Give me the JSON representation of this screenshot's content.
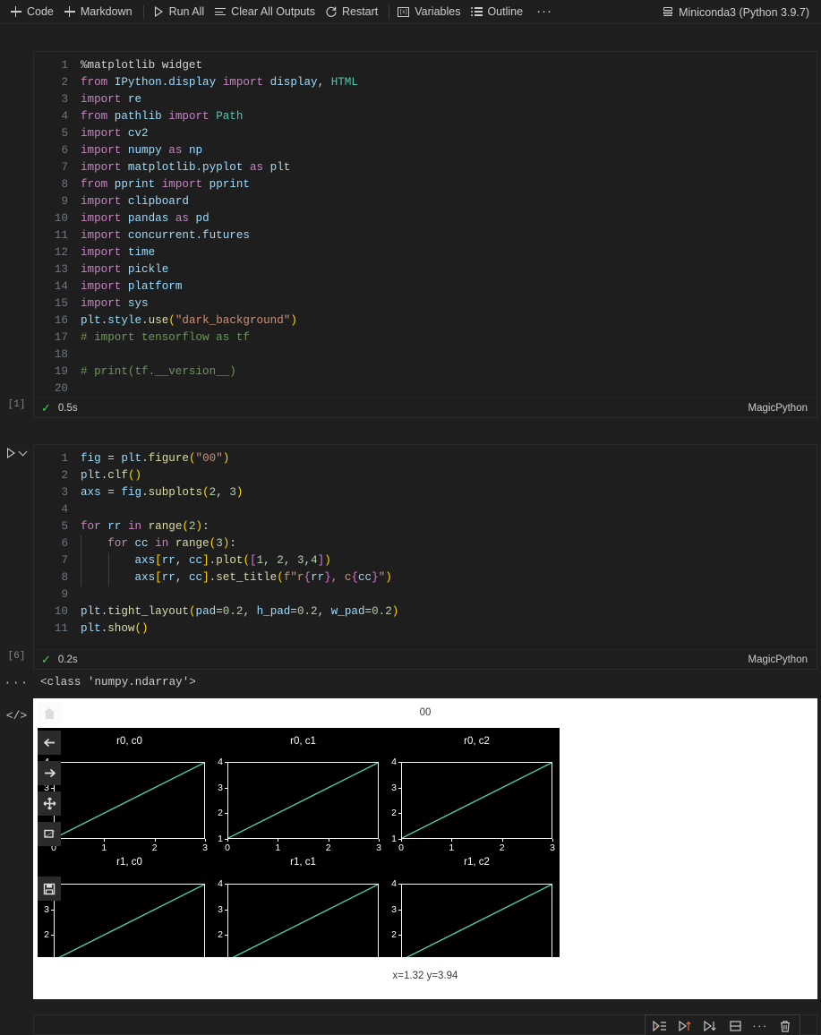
{
  "toolbar": {
    "items": [
      {
        "icon": "plus-icon",
        "label": "Code"
      },
      {
        "icon": "plus-icon",
        "label": "Markdown"
      },
      {
        "icon": "run-all-icon",
        "label": "Run All"
      },
      {
        "icon": "clear-outputs-icon",
        "label": "Clear All Outputs"
      },
      {
        "icon": "restart-icon",
        "label": "Restart"
      },
      {
        "icon": "variables-icon",
        "label": "Variables"
      },
      {
        "icon": "outline-icon",
        "label": "Outline"
      }
    ],
    "more_label": "···",
    "kernel": "Miniconda3 (Python 3.9.7)"
  },
  "cells": [
    {
      "execution_count": "[1]",
      "status_icon": "check-icon",
      "exec_time": "0.5s",
      "language_mode": "MagicPython",
      "lines": [
        {
          "n": "1",
          "tokens": [
            [
              "magic",
              "%matplotlib widget"
            ]
          ]
        },
        {
          "n": "2",
          "tokens": [
            [
              "key",
              "from"
            ],
            [
              "plain",
              " "
            ],
            [
              "mod",
              "IPython.display"
            ],
            [
              "plain",
              " "
            ],
            [
              "key",
              "import"
            ],
            [
              "plain",
              " "
            ],
            [
              "mod",
              "display"
            ],
            [
              "plain",
              ", "
            ],
            [
              "cls",
              "HTML"
            ]
          ]
        },
        {
          "n": "3",
          "tokens": [
            [
              "key",
              "import"
            ],
            [
              "plain",
              " "
            ],
            [
              "mod",
              "re"
            ]
          ]
        },
        {
          "n": "4",
          "tokens": [
            [
              "key",
              "from"
            ],
            [
              "plain",
              " "
            ],
            [
              "mod",
              "pathlib"
            ],
            [
              "plain",
              " "
            ],
            [
              "key",
              "import"
            ],
            [
              "plain",
              " "
            ],
            [
              "cls",
              "Path"
            ]
          ]
        },
        {
          "n": "5",
          "tokens": [
            [
              "key",
              "import"
            ],
            [
              "plain",
              " "
            ],
            [
              "mod",
              "cv2"
            ]
          ]
        },
        {
          "n": "6",
          "tokens": [
            [
              "key",
              "import"
            ],
            [
              "plain",
              " "
            ],
            [
              "mod",
              "numpy"
            ],
            [
              "plain",
              " "
            ],
            [
              "key",
              "as"
            ],
            [
              "plain",
              " "
            ],
            [
              "mod",
              "np"
            ]
          ]
        },
        {
          "n": "7",
          "tokens": [
            [
              "key",
              "import"
            ],
            [
              "plain",
              " "
            ],
            [
              "mod",
              "matplotlib.pyplot"
            ],
            [
              "plain",
              " "
            ],
            [
              "key",
              "as"
            ],
            [
              "plain",
              " "
            ],
            [
              "mod",
              "plt"
            ]
          ]
        },
        {
          "n": "8",
          "tokens": [
            [
              "key",
              "from"
            ],
            [
              "plain",
              " "
            ],
            [
              "mod",
              "pprint"
            ],
            [
              "plain",
              " "
            ],
            [
              "key",
              "import"
            ],
            [
              "plain",
              " "
            ],
            [
              "mod",
              "pprint"
            ]
          ]
        },
        {
          "n": "9",
          "tokens": [
            [
              "key",
              "import"
            ],
            [
              "plain",
              " "
            ],
            [
              "mod",
              "clipboard"
            ]
          ]
        },
        {
          "n": "10",
          "tokens": [
            [
              "key",
              "import"
            ],
            [
              "plain",
              " "
            ],
            [
              "mod",
              "pandas"
            ],
            [
              "plain",
              " "
            ],
            [
              "key",
              "as"
            ],
            [
              "plain",
              " "
            ],
            [
              "mod",
              "pd"
            ]
          ]
        },
        {
          "n": "11",
          "tokens": [
            [
              "key",
              "import"
            ],
            [
              "plain",
              " "
            ],
            [
              "mod",
              "concurrent.futures"
            ]
          ]
        },
        {
          "n": "12",
          "tokens": [
            [
              "key",
              "import"
            ],
            [
              "plain",
              " "
            ],
            [
              "mod",
              "time"
            ]
          ]
        },
        {
          "n": "13",
          "tokens": [
            [
              "key",
              "import"
            ],
            [
              "plain",
              " "
            ],
            [
              "mod",
              "pickle"
            ]
          ]
        },
        {
          "n": "14",
          "tokens": [
            [
              "key",
              "import"
            ],
            [
              "plain",
              " "
            ],
            [
              "mod",
              "platform"
            ]
          ]
        },
        {
          "n": "15",
          "tokens": [
            [
              "key",
              "import"
            ],
            [
              "plain",
              " "
            ],
            [
              "mod",
              "sys"
            ]
          ]
        },
        {
          "n": "16",
          "tokens": [
            [
              "var",
              "plt"
            ],
            [
              "plain",
              "."
            ],
            [
              "var",
              "style"
            ],
            [
              "plain",
              "."
            ],
            [
              "fn",
              "use"
            ],
            [
              "p1",
              "("
            ],
            [
              "str",
              "\"dark_background\""
            ],
            [
              "p1",
              ")"
            ]
          ]
        },
        {
          "n": "17",
          "tokens": [
            [
              "com",
              "# import tensorflow as tf"
            ]
          ]
        },
        {
          "n": "18",
          "tokens": []
        },
        {
          "n": "19",
          "tokens": [
            [
              "com",
              "# print(tf.__version__)"
            ]
          ]
        },
        {
          "n": "20",
          "tokens": []
        }
      ]
    },
    {
      "execution_count": "[6]",
      "status_icon": "check-icon",
      "exec_time": "0.2s",
      "language_mode": "MagicPython",
      "lines": [
        {
          "n": "1",
          "tokens": [
            [
              "var",
              "fig"
            ],
            [
              "plain",
              " "
            ],
            [
              "op",
              "="
            ],
            [
              "plain",
              " "
            ],
            [
              "var",
              "plt"
            ],
            [
              "plain",
              "."
            ],
            [
              "fn",
              "figure"
            ],
            [
              "p1",
              "("
            ],
            [
              "str",
              "\"00\""
            ],
            [
              "p1",
              ")"
            ]
          ]
        },
        {
          "n": "2",
          "tokens": [
            [
              "var",
              "plt"
            ],
            [
              "plain",
              "."
            ],
            [
              "fn",
              "clf"
            ],
            [
              "p1",
              "("
            ],
            [
              "p1",
              ")"
            ]
          ]
        },
        {
          "n": "3",
          "tokens": [
            [
              "var",
              "axs"
            ],
            [
              "plain",
              " "
            ],
            [
              "op",
              "="
            ],
            [
              "plain",
              " "
            ],
            [
              "var",
              "fig"
            ],
            [
              "plain",
              "."
            ],
            [
              "fn",
              "subplots"
            ],
            [
              "p1",
              "("
            ],
            [
              "num",
              "2"
            ],
            [
              "plain",
              ", "
            ],
            [
              "num",
              "3"
            ],
            [
              "p1",
              ")"
            ]
          ]
        },
        {
          "n": "4",
          "tokens": []
        },
        {
          "n": "5",
          "tokens": [
            [
              "key",
              "for"
            ],
            [
              "plain",
              " "
            ],
            [
              "var",
              "rr"
            ],
            [
              "plain",
              " "
            ],
            [
              "key",
              "in"
            ],
            [
              "plain",
              " "
            ],
            [
              "fn",
              "range"
            ],
            [
              "p1",
              "("
            ],
            [
              "num",
              "2"
            ],
            [
              "p1",
              ")"
            ],
            [
              "plain",
              ":"
            ]
          ]
        },
        {
          "n": "6",
          "indent": 1,
          "tokens": [
            [
              "plain",
              "    "
            ],
            [
              "key",
              "for"
            ],
            [
              "plain",
              " "
            ],
            [
              "var",
              "cc"
            ],
            [
              "plain",
              " "
            ],
            [
              "key",
              "in"
            ],
            [
              "plain",
              " "
            ],
            [
              "fn",
              "range"
            ],
            [
              "p1",
              "("
            ],
            [
              "num",
              "3"
            ],
            [
              "p1",
              ")"
            ],
            [
              "plain",
              ":"
            ]
          ]
        },
        {
          "n": "7",
          "indent": 2,
          "tokens": [
            [
              "plain",
              "        "
            ],
            [
              "var",
              "axs"
            ],
            [
              "p1",
              "["
            ],
            [
              "var",
              "rr"
            ],
            [
              "plain",
              ", "
            ],
            [
              "var",
              "cc"
            ],
            [
              "p1",
              "]"
            ],
            [
              "plain",
              "."
            ],
            [
              "fn",
              "plot"
            ],
            [
              "p1",
              "("
            ],
            [
              "p2",
              "["
            ],
            [
              "num",
              "1"
            ],
            [
              "plain",
              ", "
            ],
            [
              "num",
              "2"
            ],
            [
              "plain",
              ", "
            ],
            [
              "num",
              "3"
            ],
            [
              "plain",
              ","
            ],
            [
              "num",
              "4"
            ],
            [
              "p2",
              "]"
            ],
            [
              "p1",
              ")"
            ]
          ]
        },
        {
          "n": "8",
          "indent": 2,
          "tokens": [
            [
              "plain",
              "        "
            ],
            [
              "var",
              "axs"
            ],
            [
              "p1",
              "["
            ],
            [
              "var",
              "rr"
            ],
            [
              "plain",
              ", "
            ],
            [
              "var",
              "cc"
            ],
            [
              "p1",
              "]"
            ],
            [
              "plain",
              "."
            ],
            [
              "fn",
              "set_title"
            ],
            [
              "p1",
              "("
            ],
            [
              "str",
              "f\"r"
            ],
            [
              "p2",
              "{"
            ],
            [
              "var",
              "rr"
            ],
            [
              "p2",
              "}"
            ],
            [
              "str",
              ", c"
            ],
            [
              "p2",
              "{"
            ],
            [
              "var",
              "cc"
            ],
            [
              "p2",
              "}"
            ],
            [
              "str",
              "\""
            ],
            [
              "p1",
              ")"
            ]
          ]
        },
        {
          "n": "9",
          "tokens": []
        },
        {
          "n": "10",
          "tokens": [
            [
              "var",
              "plt"
            ],
            [
              "plain",
              "."
            ],
            [
              "fn",
              "tight_layout"
            ],
            [
              "p1",
              "("
            ],
            [
              "param",
              "pad"
            ],
            [
              "op",
              "="
            ],
            [
              "num",
              "0.2"
            ],
            [
              "plain",
              ", "
            ],
            [
              "param",
              "h_pad"
            ],
            [
              "op",
              "="
            ],
            [
              "num",
              "0.2"
            ],
            [
              "plain",
              ", "
            ],
            [
              "param",
              "w_pad"
            ],
            [
              "op",
              "="
            ],
            [
              "num",
              "0.2"
            ],
            [
              "p1",
              ")"
            ]
          ]
        },
        {
          "n": "11",
          "tokens": [
            [
              "var",
              "plt"
            ],
            [
              "plain",
              "."
            ],
            [
              "fn",
              "show"
            ],
            [
              "p1",
              "("
            ],
            [
              "p1",
              ")"
            ]
          ]
        }
      ],
      "outputs": {
        "text_gutter": "···",
        "text": "<class 'numpy.ndarray'>",
        "widget_gutter": "</>"
      }
    }
  ],
  "widget": {
    "figure_label": "00",
    "home_icon": "home-icon",
    "tools": [
      {
        "icon": "back-arrow-icon",
        "name": "back"
      },
      {
        "icon": "forward-arrow-icon",
        "name": "forward"
      },
      {
        "icon": "pan-icon",
        "name": "pan"
      },
      {
        "icon": "zoom-rect-icon",
        "name": "zoom"
      },
      {
        "icon": "save-icon",
        "name": "save"
      }
    ],
    "coord_readout": "x=1.32 y=3.94"
  },
  "chart_data": {
    "type": "line",
    "title": "00",
    "layout": {
      "rows": 2,
      "cols": 3
    },
    "x": [
      0,
      1,
      2,
      3
    ],
    "xlim": [
      0,
      3
    ],
    "ylim": [
      1,
      4
    ],
    "xticks": [
      "0",
      "1",
      "2",
      "3"
    ],
    "yticks": [
      "1",
      "2",
      "3",
      "4"
    ],
    "grid": false,
    "legend": null,
    "line_color": "#4ec9b0",
    "background": "#000000",
    "subplots": [
      {
        "title": "r0, c0",
        "values": [
          1,
          2,
          3,
          4
        ]
      },
      {
        "title": "r0, c1",
        "values": [
          1,
          2,
          3,
          4
        ]
      },
      {
        "title": "r0, c2",
        "values": [
          1,
          2,
          3,
          4
        ]
      },
      {
        "title": "r1, c0",
        "values": [
          1,
          2,
          3,
          4
        ]
      },
      {
        "title": "r1, c1",
        "values": [
          1,
          2,
          3,
          4
        ]
      },
      {
        "title": "r1, c2",
        "values": [
          1,
          2,
          3,
          4
        ]
      }
    ]
  },
  "bottom_toolbar": {
    "buttons": [
      {
        "icon": "execute-above-icon",
        "name": "execute-cells-above"
      },
      {
        "icon": "run-above-icon",
        "name": "run-above"
      },
      {
        "icon": "run-below-icon",
        "name": "run-below"
      },
      {
        "icon": "split-cell-icon",
        "name": "split-cell"
      },
      {
        "icon": "more-icon",
        "name": "more-actions",
        "label": "···"
      },
      {
        "icon": "trash-icon",
        "name": "delete-cell"
      }
    ]
  }
}
